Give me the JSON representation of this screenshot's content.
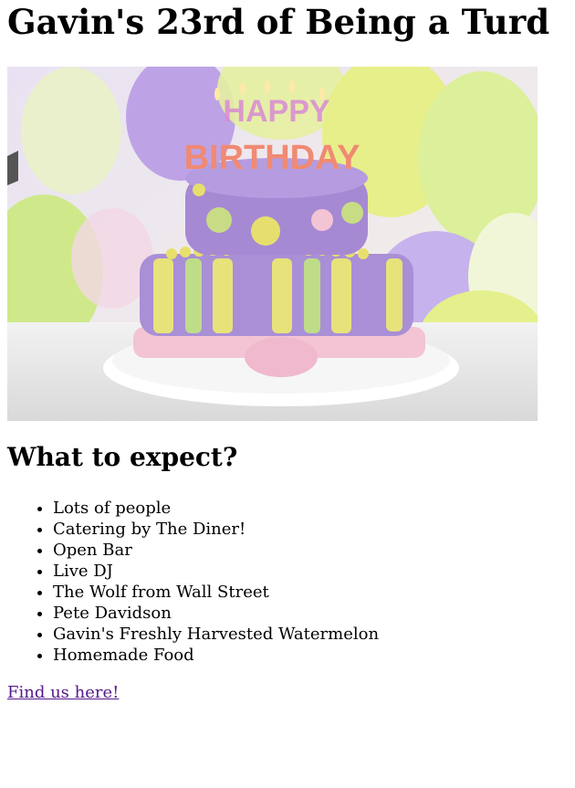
{
  "page": {
    "title": "Gavin's 23rd of Being a Turd",
    "hero_image": {
      "cake_text_line1": "HAPPY",
      "cake_text_line2": "BIRTHDAY"
    },
    "section_heading": "What to expect?",
    "expect_items": [
      "Lots of people",
      "Catering by The Diner!",
      "Open Bar",
      "Live DJ",
      "The Wolf from Wall Street",
      "Pete Davidson",
      "Gavin's Freshly Harvested Watermelon",
      "Homemade Food"
    ],
    "link_text": "Find us here!"
  },
  "colors": {
    "link_visited": "#551a8b",
    "cake_purple": "#a98fd6",
    "cake_yellow": "#e7e27a",
    "cake_pink": "#f3c4d4"
  }
}
